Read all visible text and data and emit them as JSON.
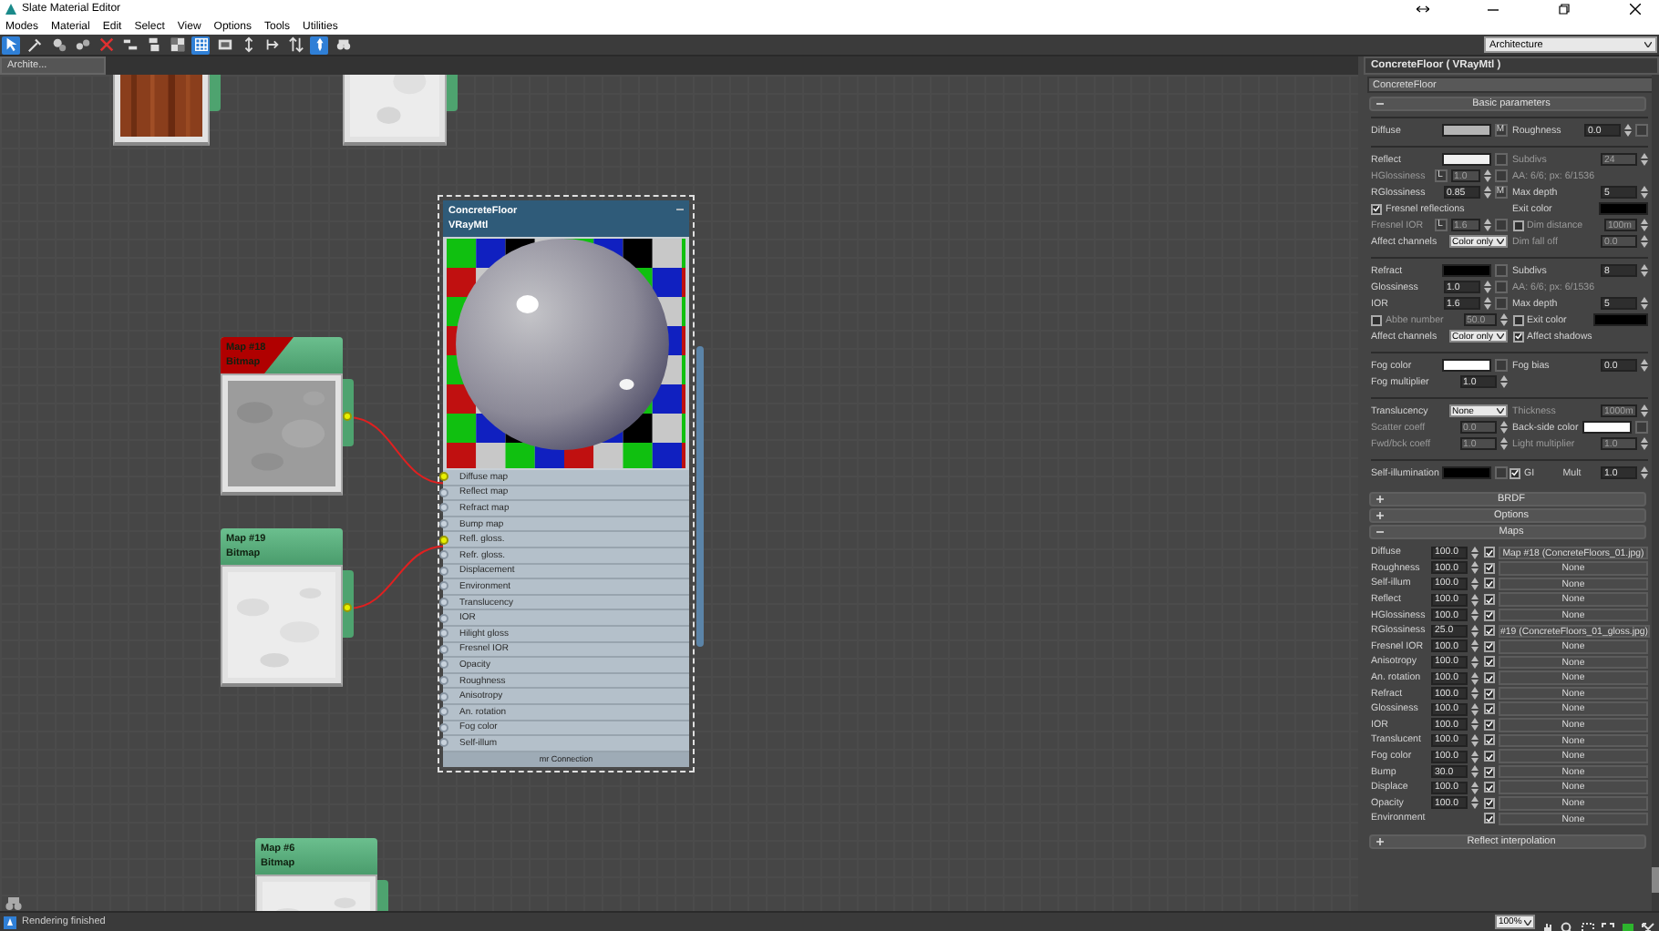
{
  "window": {
    "title": "Slate Material Editor"
  },
  "menu": [
    "Modes",
    "Material",
    "Edit",
    "Select",
    "View",
    "Options",
    "Tools",
    "Utilities"
  ],
  "toolbar": [
    {
      "kind": "pointer",
      "selected": true
    },
    {
      "kind": "picker",
      "selected": false
    },
    {
      "kind": "scene",
      "selected": false
    },
    {
      "kind": "assign",
      "selected": false
    },
    {
      "kind": "delete",
      "selected": false
    },
    {
      "kind": "move",
      "selected": false
    },
    {
      "kind": "hide",
      "selected": false
    },
    {
      "kind": "background",
      "selected": false
    },
    {
      "kind": "grid",
      "selected": true
    },
    {
      "kind": "map",
      "selected": false
    },
    {
      "kind": "layout",
      "selected": false
    },
    {
      "kind": "children",
      "selected": false
    },
    {
      "kind": "order",
      "selected": false
    },
    {
      "kind": "pin",
      "selected": true
    },
    {
      "kind": "navigate",
      "selected": false
    }
  ],
  "view_dropdown": {
    "value": "Architecture"
  },
  "view_tab": {
    "label": "Archite..."
  },
  "canvas": {
    "nodes": [
      {
        "kind": "tile"
      },
      {
        "kind": "tile"
      },
      {
        "kind": "material",
        "title": "ConcreteFloor",
        "subtitle": "VRayMtl",
        "selected": true,
        "footer": "mr Connection",
        "slots": [
          {
            "label": "Diffuse map",
            "connected": true
          },
          {
            "label": "Reflect map",
            "connected": false
          },
          {
            "label": "Refract map",
            "connected": false
          },
          {
            "label": "Bump map",
            "connected": false
          },
          {
            "label": "Refl. gloss.",
            "connected": true
          },
          {
            "label": "Refr. gloss.",
            "connected": false
          },
          {
            "label": "Displacement",
            "connected": false
          },
          {
            "label": "Environment",
            "connected": false
          },
          {
            "label": "Translucency",
            "connected": false
          },
          {
            "label": "IOR",
            "connected": false
          },
          {
            "label": "Hilight gloss",
            "connected": false
          },
          {
            "label": "Fresnel IOR",
            "connected": false
          },
          {
            "label": "Opacity",
            "connected": false
          },
          {
            "label": "Roughness",
            "connected": false
          },
          {
            "label": "Anisotropy",
            "connected": false
          },
          {
            "label": "An. rotation",
            "connected": false
          },
          {
            "label": "Fog color",
            "connected": false
          },
          {
            "label": "Self-illum",
            "connected": false
          }
        ]
      },
      {
        "kind": "map",
        "title": "Map #18",
        "subtitle": "Bitmap",
        "warning": true,
        "output_connected": true
      },
      {
        "kind": "map",
        "title": "Map #19",
        "subtitle": "Bitmap",
        "warning": false,
        "output_connected": true
      },
      {
        "kind": "map",
        "title": "Map #6",
        "subtitle": "Bitmap",
        "warning": false
      }
    ]
  },
  "panel": {
    "title": "ConcreteFloor ( VRayMtl )",
    "name": "ConcreteFloor"
  },
  "parameters": {
    "title": "Basic parameters",
    "expanded": true,
    "groups": [
      [
        [
          {
            "kind": "swatch",
            "label": "Diffuse",
            "color": "#b4b4b4",
            "map": "M"
          },
          {
            "kind": "spinner",
            "label": "Roughness",
            "value": "0.0",
            "slot": true
          }
        ]
      ],
      [
        [
          {
            "kind": "swatch",
            "label": "Reflect",
            "color": "#f0f0f0",
            "slot": true
          },
          {
            "kind": "spinner",
            "label": "Subdivs",
            "value": "24",
            "disabled": true
          }
        ],
        [
          {
            "kind": "spinner",
            "label": "HGlossiness",
            "lock": "L",
            "value": "1.0",
            "disabled": true,
            "slot": true
          },
          {
            "kind": "info",
            "label": "AA: 6/6; px: 6/1536"
          }
        ],
        [
          {
            "kind": "spinner",
            "label": "RGlossiness",
            "value": "0.85",
            "map": "M"
          },
          {
            "kind": "spinner",
            "label": "Max depth",
            "value": "5"
          }
        ],
        [
          {
            "kind": "check",
            "label": "Fresnel reflections",
            "checked": true
          },
          {
            "kind": "swatch",
            "label": "Exit color",
            "color": "#000000"
          }
        ],
        [
          {
            "kind": "spinner",
            "label": "Fresnel IOR",
            "lock": "L",
            "value": "1.6",
            "disabled": true,
            "slot": true
          },
          {
            "kind": "checkspinner",
            "label": "Dim distance",
            "checked": false,
            "value": "100m",
            "disabled": true
          }
        ],
        [
          {
            "kind": "select",
            "label": "Affect channels",
            "value": "Color only"
          },
          {
            "kind": "spinner",
            "label": "Dim fall off",
            "value": "0.0",
            "disabled": true
          }
        ]
      ],
      [
        [
          {
            "kind": "swatch",
            "label": "Refract",
            "color": "#000000",
            "slot": true
          },
          {
            "kind": "spinner",
            "label": "Subdivs",
            "value": "8"
          }
        ],
        [
          {
            "kind": "spinner",
            "label": "Glossiness",
            "value": "1.0",
            "slot": true
          },
          {
            "kind": "info",
            "label": "AA: 6/6; px: 6/1536"
          }
        ],
        [
          {
            "kind": "spinner",
            "label": "IOR",
            "value": "1.6",
            "slot": true
          },
          {
            "kind": "spinner",
            "label": "Max depth",
            "value": "5"
          }
        ],
        [
          {
            "kind": "checkspinner",
            "label": "Abbe number",
            "checked": false,
            "value": "50.0",
            "disabled": true
          },
          {
            "kind": "checkswatch",
            "label": "Exit color",
            "checked": false,
            "color": "#000000"
          }
        ],
        [
          {
            "kind": "select",
            "label": "Affect channels",
            "value": "Color only"
          },
          {
            "kind": "check",
            "label": "Affect shadows",
            "checked": true
          }
        ]
      ],
      [
        [
          {
            "kind": "swatch",
            "label": "Fog color",
            "color": "#ffffff",
            "slot": true
          },
          {
            "kind": "spinner",
            "label": "Fog bias",
            "value": "0.0"
          }
        ],
        [
          {
            "kind": "spinner",
            "label": "Fog multiplier",
            "value": "1.0"
          }
        ]
      ],
      [
        [
          {
            "kind": "select",
            "label": "Translucency",
            "value": "None"
          },
          {
            "kind": "spinner",
            "label": "Thickness",
            "value": "1000m",
            "disabled": true
          }
        ],
        [
          {
            "kind": "spinner",
            "label": "Scatter coeff",
            "value": "0.0",
            "disabled": true
          },
          {
            "kind": "swatch",
            "label": "Back-side color",
            "color": "#ffffff",
            "slot": true
          }
        ],
        [
          {
            "kind": "spinner",
            "label": "Fwd/bck coeff",
            "value": "1.0",
            "disabled": true
          },
          {
            "kind": "spinner",
            "label": "Light multiplier",
            "value": "1.0",
            "disabled": true
          }
        ]
      ],
      [
        [
          {
            "kind": "swatch",
            "label": "Self-illumination",
            "color": "#000000",
            "slot": true
          },
          {
            "kind": "check",
            "label": "GI",
            "checked": true
          },
          {
            "kind": "spinner",
            "label": "Mult",
            "value": "1.0"
          }
        ]
      ]
    ]
  },
  "rollouts": [
    {
      "label": "BRDF",
      "expanded": false
    },
    {
      "label": "Options",
      "expanded": false
    },
    {
      "label": "Maps",
      "expanded": true
    }
  ],
  "maps": [
    {
      "label": "Diffuse",
      "amount": "100.0",
      "checked": true,
      "map": "Map #18 (ConcreteFloors_01.jpg)"
    },
    {
      "label": "Roughness",
      "amount": "100.0",
      "checked": true,
      "map": "None"
    },
    {
      "label": "Self-illum",
      "amount": "100.0",
      "checked": true,
      "map": "None"
    },
    {
      "label": "Reflect",
      "amount": "100.0",
      "checked": true,
      "map": "None"
    },
    {
      "label": "HGlossiness",
      "amount": "100.0",
      "checked": true,
      "map": "None"
    },
    {
      "label": "RGlossiness",
      "amount": "25.0",
      "checked": true,
      "map": "#19 (ConcreteFloors_01_gloss.jpg)"
    },
    {
      "label": "Fresnel IOR",
      "amount": "100.0",
      "checked": true,
      "map": "None"
    },
    {
      "label": "Anisotropy",
      "amount": "100.0",
      "checked": true,
      "map": "None"
    },
    {
      "label": "An. rotation",
      "amount": "100.0",
      "checked": true,
      "map": "None"
    },
    {
      "label": "Refract",
      "amount": "100.0",
      "checked": true,
      "map": "None"
    },
    {
      "label": "Glossiness",
      "amount": "100.0",
      "checked": true,
      "map": "None"
    },
    {
      "label": "IOR",
      "amount": "100.0",
      "checked": true,
      "map": "None"
    },
    {
      "label": "Translucent",
      "amount": "100.0",
      "checked": true,
      "map": "None"
    },
    {
      "label": "Fog color",
      "amount": "100.0",
      "checked": true,
      "map": "None"
    },
    {
      "label": "Bump",
      "amount": "30.0",
      "checked": true,
      "map": "None"
    },
    {
      "label": "Displace",
      "amount": "100.0",
      "checked": true,
      "map": "None"
    },
    {
      "label": "Opacity",
      "amount": "100.0",
      "checked": true,
      "map": "None"
    },
    {
      "label": "Environment",
      "checked": true,
      "map": "None"
    }
  ],
  "last_rollout": {
    "label": "Reflect interpolation",
    "expanded": false
  },
  "status": {
    "message": "Rendering finished",
    "zoom": "100%"
  }
}
